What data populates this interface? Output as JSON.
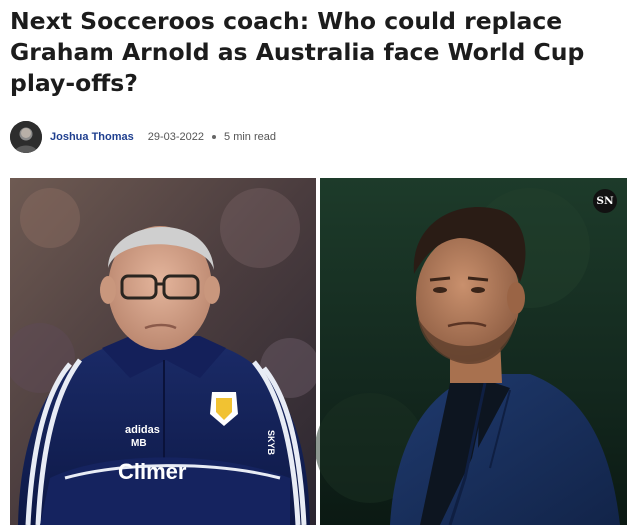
{
  "article": {
    "headline": "Next Socceroos coach: Who could replace Graham Arnold as Australia face World Cup play-offs?",
    "author": "Joshua Thomas",
    "date": "29-03-2022",
    "read_time": "5 min read"
  },
  "hero": {
    "badge": "SN",
    "left_photo": "man-with-glasses-in-navy-tracksuit",
    "right_photo": "man-with-beard-in-navy-blazer",
    "jacket_texts": [
      "adidas",
      "MB",
      "Climer",
      "SKYB"
    ]
  },
  "colors": {
    "author_link": "#1f3f8f",
    "headline": "#1c1c1c"
  }
}
